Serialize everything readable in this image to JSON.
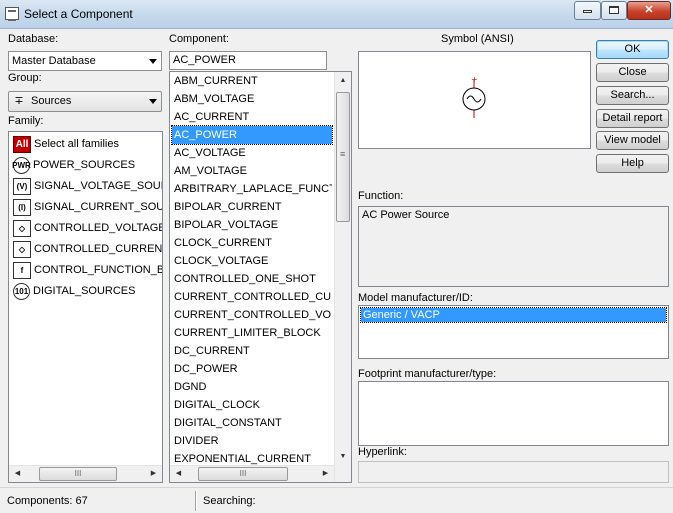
{
  "window": {
    "title": "Select a Component",
    "controls": {
      "minimize": "minimize",
      "maximize": "maximize",
      "close": "✕"
    }
  },
  "database": {
    "label": "Database:",
    "value": "Master Database"
  },
  "group": {
    "label": "Group:",
    "value": "Sources",
    "icon": "sources-icon"
  },
  "family": {
    "label": "Family:",
    "items": [
      {
        "label": "Select all families",
        "icon_text": "All",
        "icon": "all-families-icon"
      },
      {
        "label": "POWER_SOURCES",
        "icon_text": "PWR",
        "icon": "power-sources-icon"
      },
      {
        "label": "SIGNAL_VOLTAGE_SOURC",
        "icon_text": "(V)",
        "icon": "signal-voltage-icon"
      },
      {
        "label": "SIGNAL_CURRENT_SOURC",
        "icon_text": "(I)",
        "icon": "signal-current-icon"
      },
      {
        "label": "CONTROLLED_VOLTAGE_S",
        "icon_text": "◇",
        "icon": "controlled-voltage-icon"
      },
      {
        "label": "CONTROLLED_CURRENT_",
        "icon_text": "◇",
        "icon": "controlled-current-icon"
      },
      {
        "label": "CONTROL_FUNCTION_BLO",
        "icon_text": "f",
        "icon": "control-function-icon"
      },
      {
        "label": "DIGITAL_SOURCES",
        "icon_text": "101",
        "icon": "digital-sources-icon"
      }
    ]
  },
  "component": {
    "label": "Component:",
    "search_value": "AC_POWER",
    "selected": "AC_POWER",
    "items": [
      "ABM_CURRENT",
      "ABM_VOLTAGE",
      "AC_CURRENT",
      "AC_POWER",
      "AC_VOLTAGE",
      "AM_VOLTAGE",
      "ARBITRARY_LAPLACE_FUNCTION",
      "BIPOLAR_CURRENT",
      "BIPOLAR_VOLTAGE",
      "CLOCK_CURRENT",
      "CLOCK_VOLTAGE",
      "CONTROLLED_ONE_SHOT",
      "CURRENT_CONTROLLED_CURRE",
      "CURRENT_CONTROLLED_VOLTAC",
      "CURRENT_LIMITER_BLOCK",
      "DC_CURRENT",
      "DC_POWER",
      "DGND",
      "DIGITAL_CLOCK",
      "DIGITAL_CONSTANT",
      "DIVIDER",
      "EXPONENTIAL_CURRENT"
    ]
  },
  "symbol": {
    "label": "Symbol (ANSI)",
    "icon": "ac-source-symbol"
  },
  "function": {
    "label": "Function:",
    "value": "AC Power Source"
  },
  "model": {
    "label": "Model manufacturer/ID:",
    "value": "Generic / VACP"
  },
  "footprint": {
    "label": "Footprint manufacturer/type:",
    "value": ""
  },
  "hyperlink": {
    "label": "Hyperlink:",
    "value": ""
  },
  "buttons": {
    "ok": "OK",
    "close": "Close",
    "search": "Search...",
    "detail_report": "Detail report",
    "view_model": "View model",
    "help": "Help"
  },
  "status": {
    "components": "Components: 67",
    "searching": "Searching:"
  },
  "scroll_glyphs": {
    "up": "▲",
    "down": "▼",
    "left": "◀",
    "right": "▶",
    "grip": "III",
    "vgrip": "≡"
  }
}
